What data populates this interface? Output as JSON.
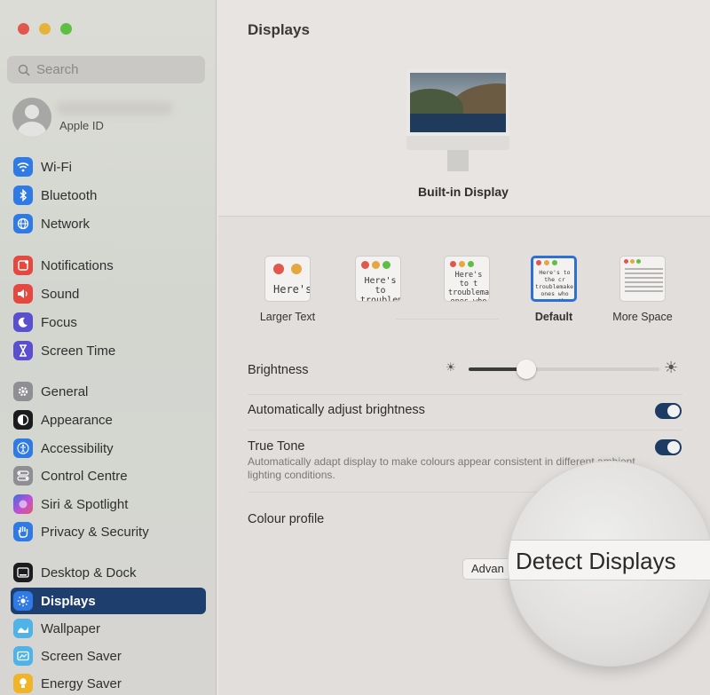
{
  "sidebar": {
    "search_placeholder": "Search",
    "apple_id_label": "Apple ID",
    "items": [
      {
        "label": "Wi-Fi",
        "icon": "wifi-icon",
        "color": "#2f7ae5"
      },
      {
        "label": "Bluetooth",
        "icon": "bluetooth-icon",
        "color": "#2f7ae5"
      },
      {
        "label": "Network",
        "icon": "network-globe-icon",
        "color": "#2f7ae5"
      },
      {
        "label": "Notifications",
        "icon": "notifications-icon",
        "color": "#e5483f"
      },
      {
        "label": "Sound",
        "icon": "sound-icon",
        "color": "#e5483f"
      },
      {
        "label": "Focus",
        "icon": "focus-moon-icon",
        "color": "#5a4fcf"
      },
      {
        "label": "Screen Time",
        "icon": "hourglass-icon",
        "color": "#5a4fcf"
      },
      {
        "label": "General",
        "icon": "gear-icon",
        "color": "#8e8e93"
      },
      {
        "label": "Appearance",
        "icon": "appearance-icon",
        "color": "#1c1c1e"
      },
      {
        "label": "Accessibility",
        "icon": "accessibility-icon",
        "color": "#2f7ae5"
      },
      {
        "label": "Control Centre",
        "icon": "control-centre-icon",
        "color": "#8e8e93"
      },
      {
        "label": "Siri & Spotlight",
        "icon": "siri-icon",
        "color": "#a24fd6"
      },
      {
        "label": "Privacy & Security",
        "icon": "hand-icon",
        "color": "#2f7ae5"
      },
      {
        "label": "Desktop & Dock",
        "icon": "dock-icon",
        "color": "#1c1c1e"
      },
      {
        "label": "Displays",
        "icon": "displays-sun-icon",
        "color": "#2f7ae5"
      },
      {
        "label": "Wallpaper",
        "icon": "wallpaper-icon",
        "color": "#4fb3e8"
      },
      {
        "label": "Screen Saver",
        "icon": "screen-saver-icon",
        "color": "#4fb3e8"
      },
      {
        "label": "Energy Saver",
        "icon": "bulb-icon",
        "color": "#f0b429"
      }
    ],
    "active_item": "Displays"
  },
  "main": {
    "title": "Displays",
    "display_name": "Built-in Display",
    "resolution_options": [
      {
        "label": "Larger Text",
        "thumb_text": "Here's"
      },
      {
        "label": "",
        "thumb_text": "Here's to troublem"
      },
      {
        "label": "",
        "thumb_text": "Here's to t troublema ones who"
      },
      {
        "label": "Default",
        "thumb_text": "Here's to the cr troublemakers. ones who see th rules. And they"
      },
      {
        "label": "More Space",
        "thumb_text": ""
      }
    ],
    "brightness_label": "Brightness",
    "brightness_value": 0.3,
    "auto_brightness_label": "Automatically adjust brightness",
    "auto_brightness_on": true,
    "true_tone_label": "True Tone",
    "true_tone_description": "Automatically adapt display to make colours appear consistent in different ambient lighting conditions.",
    "true_tone_on": true,
    "colour_profile_label": "Colour profile",
    "advanced_button": "Advan",
    "detect_button": "Detect Displays"
  }
}
